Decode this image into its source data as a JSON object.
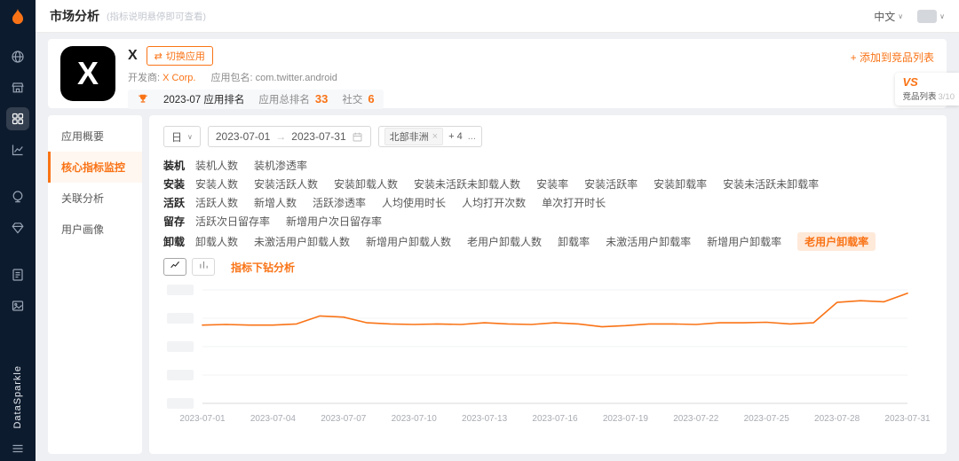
{
  "colors": {
    "accent": "#f97316",
    "sidebar_bg": "#0d1b2e"
  },
  "sidebar": {
    "brand": "DataSparkle",
    "icons": [
      {
        "name": "globe-icon",
        "icon": "globe",
        "active": false,
        "gap": false
      },
      {
        "name": "market-icon",
        "icon": "market",
        "active": false,
        "gap": false
      },
      {
        "name": "apps-grid-icon",
        "icon": "grid",
        "active": true,
        "gap": false
      },
      {
        "name": "trend-chart-icon",
        "icon": "trend",
        "active": false,
        "gap": false
      },
      {
        "name": "world-analysis-icon",
        "icon": "world",
        "active": false,
        "gap": true
      },
      {
        "name": "gem-icon",
        "icon": "gem",
        "active": false,
        "gap": false
      },
      {
        "name": "report-icon",
        "icon": "report",
        "active": false,
        "gap": true
      },
      {
        "name": "gallery-icon",
        "icon": "gallery",
        "active": false,
        "gap": false
      }
    ]
  },
  "header": {
    "title": "市场分析",
    "subtitle": "(指标说明悬停即可查看)",
    "language": "中文"
  },
  "app_card": {
    "app_name": "X",
    "switch_icon": "⇄",
    "switch_app_label": "切换应用",
    "developer_label": "开发商:",
    "developer": "X Corp.",
    "package_label": "应用包名:",
    "package": "com.twitter.android",
    "rank_period": "2023-07 应用排名",
    "total_rank_label": "应用总排名",
    "total_rank": "33",
    "category_label": "社交",
    "category_rank": "6",
    "add_competitor_label": "+ 添加到竞品列表",
    "vs_label": "VS",
    "competitor_list_label": "竞品列表",
    "competitor_count": "3/10"
  },
  "submenu": [
    {
      "label": "应用概要",
      "active": false
    },
    {
      "label": "核心指标监控",
      "active": true
    },
    {
      "label": "关联分析",
      "active": false
    },
    {
      "label": "用户画像",
      "active": false
    }
  ],
  "filters": {
    "granularity": "日",
    "date_start": "2023-07-01",
    "date_end": "2023-07-31",
    "region_tag": "北部非洲",
    "region_more": "+ 4",
    "region_ellipsis": "..."
  },
  "metric_groups": [
    {
      "label": "装机",
      "metrics": [
        "装机人数",
        "装机渗透率"
      ],
      "selected": ""
    },
    {
      "label": "安装",
      "metrics": [
        "安装人数",
        "安装活跃人数",
        "安装卸载人数",
        "安装未活跃未卸载人数",
        "安装率",
        "安装活跃率",
        "安装卸载率",
        "安装未活跃未卸载率"
      ],
      "selected": ""
    },
    {
      "label": "活跃",
      "metrics": [
        "活跃人数",
        "新增人数",
        "活跃渗透率",
        "人均使用时长",
        "人均打开次数",
        "单次打开时长"
      ],
      "selected": ""
    },
    {
      "label": "留存",
      "metrics": [
        "活跃次日留存率",
        "新增用户次日留存率"
      ],
      "selected": ""
    },
    {
      "label": "卸载",
      "metrics": [
        "卸载人数",
        "未激活用户卸载人数",
        "新增用户卸载人数",
        "老用户卸载人数",
        "卸载率",
        "未激活用户卸载率",
        "新增用户卸载率",
        "老用户卸载率"
      ],
      "selected": "老用户卸载率"
    }
  ],
  "toolbar": {
    "drilldown_label": "指标下钻分析"
  },
  "chart_data": {
    "type": "line",
    "title": "",
    "xlabel": "",
    "ylabel": "",
    "legend": false,
    "grid": true,
    "y_axis_labels_redacted": true,
    "ylim": [
      0,
      100
    ],
    "x": [
      "2023-07-01",
      "2023-07-02",
      "2023-07-03",
      "2023-07-04",
      "2023-07-05",
      "2023-07-06",
      "2023-07-07",
      "2023-07-08",
      "2023-07-09",
      "2023-07-10",
      "2023-07-11",
      "2023-07-12",
      "2023-07-13",
      "2023-07-14",
      "2023-07-15",
      "2023-07-16",
      "2023-07-17",
      "2023-07-18",
      "2023-07-19",
      "2023-07-20",
      "2023-07-21",
      "2023-07-22",
      "2023-07-23",
      "2023-07-24",
      "2023-07-25",
      "2023-07-26",
      "2023-07-27",
      "2023-07-28",
      "2023-07-29",
      "2023-07-30",
      "2023-07-31"
    ],
    "x_tick_labels": [
      "2023-07-01",
      "2023-07-04",
      "2023-07-07",
      "2023-07-10",
      "2023-07-13",
      "2023-07-16",
      "2023-07-19",
      "2023-07-22",
      "2023-07-25",
      "2023-07-28",
      "2023-07-31"
    ],
    "series": [
      {
        "name": "老用户卸载率",
        "color": "#f97316",
        "values": [
          69,
          69.5,
          69,
          69,
          70,
          77,
          76,
          71,
          70,
          69.5,
          70,
          69.5,
          71,
          70,
          69.5,
          71,
          70,
          67.5,
          68.5,
          70,
          70,
          69.5,
          71,
          71,
          71.5,
          70,
          71,
          89,
          90.5,
          89.5,
          97
        ]
      }
    ]
  }
}
